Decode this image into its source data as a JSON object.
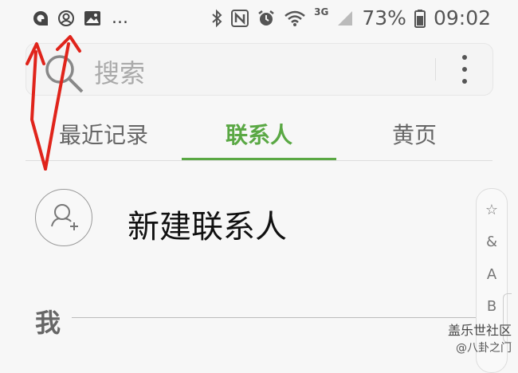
{
  "status_bar": {
    "overflow": "...",
    "network_type": "3G",
    "battery": "73%",
    "time": "09:02",
    "icons_left": [
      "app-q-icon",
      "account-icon",
      "image-icon"
    ],
    "icons_right": [
      "bluetooth-icon",
      "nfc-icon",
      "alarm-icon",
      "wifi-icon",
      "signal-icon",
      "battery-icon"
    ]
  },
  "search": {
    "placeholder": "搜索"
  },
  "tabs": [
    {
      "label": "最近记录",
      "active": false
    },
    {
      "label": "联系人",
      "active": true
    },
    {
      "label": "黄页",
      "active": false
    }
  ],
  "new_contact": {
    "label": "新建联系人"
  },
  "section": {
    "me": "我"
  },
  "index_bar": [
    "☆",
    "&",
    "A",
    "B"
  ],
  "watermark": {
    "line1": "盖乐世社区",
    "line2": "@八卦之门"
  },
  "colors": {
    "accent": "#5aa844",
    "annotation": "#e0241b"
  }
}
